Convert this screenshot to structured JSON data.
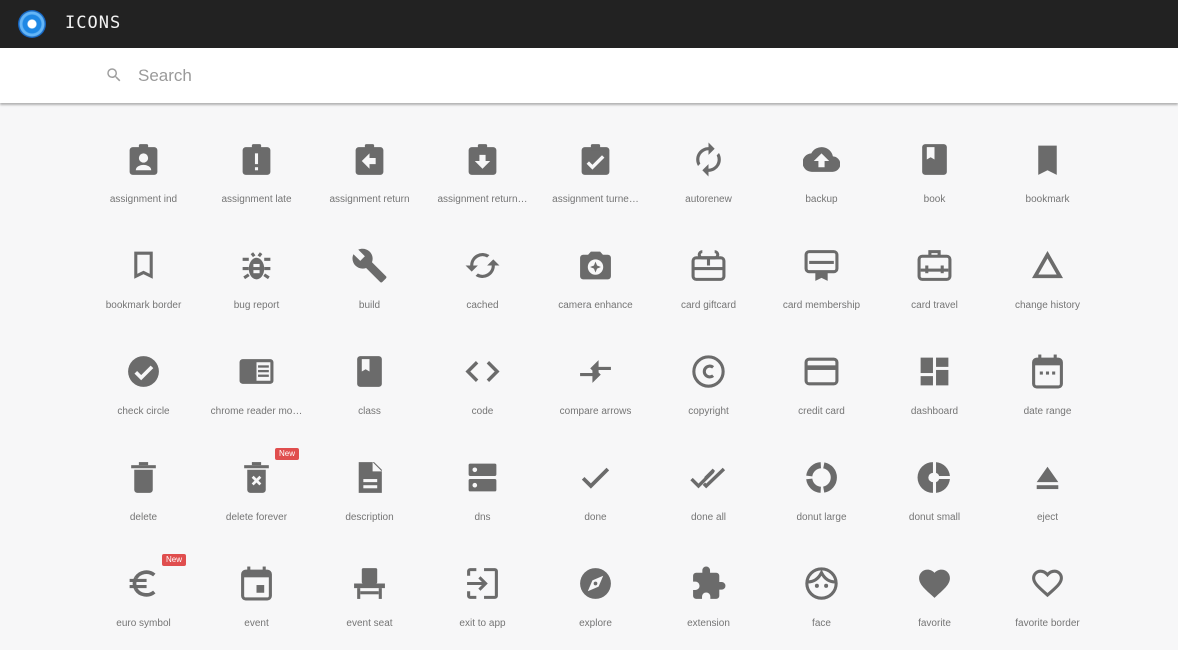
{
  "app": {
    "title": "ICONS"
  },
  "search": {
    "placeholder": "Search",
    "value": ""
  },
  "badge_label": "New",
  "icons": [
    {
      "label": "assignment ind",
      "name": "assignment-ind-icon"
    },
    {
      "label": "assignment late",
      "name": "assignment-late-icon"
    },
    {
      "label": "assignment return",
      "name": "assignment-return-icon"
    },
    {
      "label": "assignment return…",
      "name": "assignment-returned-icon"
    },
    {
      "label": "assignment turne…",
      "name": "assignment-turned-in-icon"
    },
    {
      "label": "autorenew",
      "name": "autorenew-icon"
    },
    {
      "label": "backup",
      "name": "backup-icon"
    },
    {
      "label": "book",
      "name": "book-icon"
    },
    {
      "label": "bookmark",
      "name": "bookmark-icon"
    },
    {
      "label": "bookmark border",
      "name": "bookmark-border-icon"
    },
    {
      "label": "bug report",
      "name": "bug-report-icon"
    },
    {
      "label": "build",
      "name": "build-icon"
    },
    {
      "label": "cached",
      "name": "cached-icon"
    },
    {
      "label": "camera enhance",
      "name": "camera-enhance-icon"
    },
    {
      "label": "card giftcard",
      "name": "card-giftcard-icon"
    },
    {
      "label": "card membership",
      "name": "card-membership-icon"
    },
    {
      "label": "card travel",
      "name": "card-travel-icon"
    },
    {
      "label": "change history",
      "name": "change-history-icon"
    },
    {
      "label": "check circle",
      "name": "check-circle-icon"
    },
    {
      "label": "chrome reader mo…",
      "name": "chrome-reader-mode-icon"
    },
    {
      "label": "class",
      "name": "class-icon"
    },
    {
      "label": "code",
      "name": "code-icon"
    },
    {
      "label": "compare arrows",
      "name": "compare-arrows-icon"
    },
    {
      "label": "copyright",
      "name": "copyright-icon"
    },
    {
      "label": "credit card",
      "name": "credit-card-icon"
    },
    {
      "label": "dashboard",
      "name": "dashboard-icon"
    },
    {
      "label": "date range",
      "name": "date-range-icon"
    },
    {
      "label": "delete",
      "name": "delete-icon"
    },
    {
      "label": "delete forever",
      "name": "delete-forever-icon",
      "badge": true
    },
    {
      "label": "description",
      "name": "description-icon"
    },
    {
      "label": "dns",
      "name": "dns-icon"
    },
    {
      "label": "done",
      "name": "done-icon"
    },
    {
      "label": "done all",
      "name": "done-all-icon"
    },
    {
      "label": "donut large",
      "name": "donut-large-icon"
    },
    {
      "label": "donut small",
      "name": "donut-small-icon"
    },
    {
      "label": "eject",
      "name": "eject-icon"
    },
    {
      "label": "euro symbol",
      "name": "euro-symbol-icon",
      "badge": true
    },
    {
      "label": "event",
      "name": "event-icon"
    },
    {
      "label": "event seat",
      "name": "event-seat-icon"
    },
    {
      "label": "exit to app",
      "name": "exit-to-app-icon"
    },
    {
      "label": "explore",
      "name": "explore-icon"
    },
    {
      "label": "extension",
      "name": "extension-icon"
    },
    {
      "label": "face",
      "name": "face-icon"
    },
    {
      "label": "favorite",
      "name": "favorite-icon"
    },
    {
      "label": "favorite border",
      "name": "favorite-border-icon"
    }
  ],
  "colors": {
    "topbar": "#222222",
    "icon": "#6b6b6b",
    "label": "#757575",
    "badge": "#e04e4e",
    "background": "#f7f7f8"
  }
}
